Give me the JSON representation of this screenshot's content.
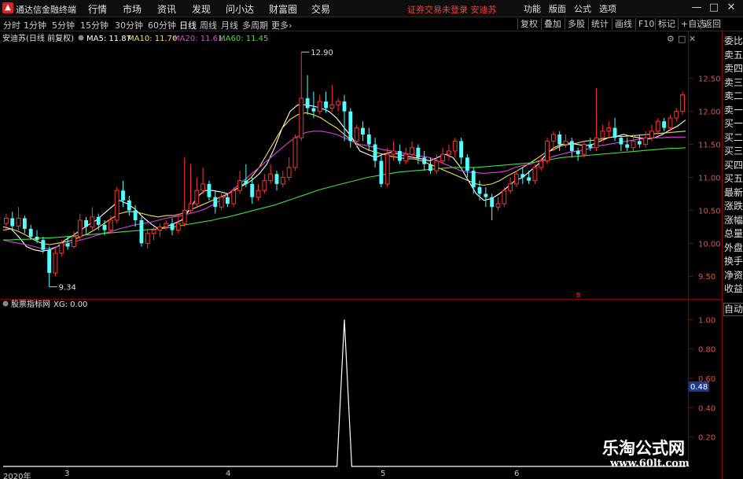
{
  "menubar": {
    "app_name": "通达信金融终端",
    "menus": [
      "行情",
      "市场",
      "资讯",
      "发现",
      "问小达",
      "财富圈",
      "交易"
    ],
    "notice": "证券交易未登录",
    "stock_name": "安迪苏",
    "right_menus": [
      "功能",
      "版面",
      "公式",
      "选项"
    ],
    "window_buttons": [
      "—",
      "□",
      "✕"
    ]
  },
  "toolbar": {
    "periods": [
      "分时",
      "1分钟",
      "5分钟",
      "15分钟",
      "30分钟",
      "60分钟",
      "日线",
      "周线",
      "月线",
      "多周期",
      "更多"
    ],
    "active_period": "日线",
    "buttons": [
      "复权",
      "叠加",
      "多股",
      "统计",
      "画线",
      "F10",
      "标记",
      "+自选",
      "返回"
    ]
  },
  "main_chart": {
    "title": "安迪苏(日线 前复权)",
    "ma_labels": [
      {
        "text": "MA5: 11.87",
        "color": "#ffffff"
      },
      {
        "text": "MA10: 11.70",
        "color": "#f0e060"
      },
      {
        "text": "MA20: 11.61",
        "color": "#e040e0"
      },
      {
        "text": "MA60: 11.45",
        "color": "#40e040"
      }
    ],
    "high_label": "12.90",
    "low_label": "9.34",
    "marker": "B"
  },
  "sub_chart": {
    "title": "股票指标网",
    "xg_label": "XG: 0.00",
    "current_value": "0.48"
  },
  "side_panel": {
    "items": [
      "委比",
      "卖五",
      "卖四",
      "卖三",
      "卖二",
      "卖一",
      "买一",
      "买二",
      "买三",
      "买四",
      "买五",
      "最新",
      "涨跌",
      "涨幅",
      "总量",
      "外盘",
      "换手",
      "净资",
      "收益"
    ],
    "auto_label": "自动"
  },
  "date_axis": [
    "2020年",
    "3",
    "4",
    "5",
    "6"
  ],
  "watermark": {
    "title": "乐淘公式网",
    "url": "www.60lt.com"
  },
  "colors": {
    "up": "#ff3232",
    "down": "#54ffff",
    "ma5": "#ffffff",
    "ma10": "#f0e060",
    "ma20": "#e040e0",
    "ma60": "#40e040",
    "frame": "#880000"
  },
  "chart_data": [
    {
      "type": "candlestick",
      "title": "安迪苏(日线 前复权)",
      "ylim": [
        9.3,
        12.95
      ],
      "y_ticks": [
        9.5,
        10.0,
        10.5,
        11.0,
        11.5,
        12.0,
        12.5
      ],
      "candles": [
        [
          10.3,
          10.38,
          10.45,
          10.18
        ],
        [
          10.38,
          10.26,
          10.48,
          10.2
        ],
        [
          10.26,
          10.38,
          10.55,
          10.2
        ],
        [
          10.38,
          10.22,
          10.42,
          10.15
        ],
        [
          10.22,
          10.1,
          10.28,
          10.05
        ],
        [
          10.1,
          10.05,
          10.2,
          10.0
        ],
        [
          10.05,
          9.9,
          10.1,
          9.85
        ],
        [
          9.9,
          9.55,
          9.95,
          9.34
        ],
        [
          9.55,
          9.85,
          9.92,
          9.5
        ],
        [
          9.85,
          10.0,
          10.05,
          9.8
        ],
        [
          10.0,
          9.95,
          10.1,
          9.9
        ],
        [
          9.95,
          10.1,
          10.18,
          9.92
        ],
        [
          10.1,
          10.35,
          10.45,
          10.05
        ],
        [
          10.35,
          10.25,
          10.4,
          10.15
        ],
        [
          10.25,
          10.4,
          10.55,
          10.2
        ],
        [
          10.4,
          10.28,
          10.45,
          10.2
        ],
        [
          10.28,
          10.2,
          10.35,
          10.12
        ],
        [
          10.2,
          10.35,
          10.42,
          10.15
        ],
        [
          10.35,
          10.8,
          10.85,
          10.3
        ],
        [
          10.8,
          10.65,
          10.95,
          10.55
        ],
        [
          10.65,
          10.5,
          10.72,
          10.42
        ],
        [
          10.5,
          10.35,
          10.58,
          10.25
        ],
        [
          10.35,
          10.0,
          10.4,
          9.95
        ],
        [
          10.0,
          10.15,
          10.22,
          9.92
        ],
        [
          10.15,
          10.2,
          10.25,
          10.05
        ],
        [
          10.2,
          10.25,
          10.3,
          10.1
        ],
        [
          10.25,
          10.3,
          10.35,
          10.2
        ],
        [
          10.3,
          10.2,
          10.38,
          10.12
        ],
        [
          10.2,
          10.3,
          10.45,
          10.15
        ],
        [
          10.3,
          10.5,
          11.3,
          10.25
        ],
        [
          10.5,
          10.6,
          11.2,
          10.45
        ],
        [
          10.6,
          10.8,
          11.0,
          10.55
        ],
        [
          10.8,
          10.9,
          11.15,
          10.75
        ],
        [
          10.9,
          10.7,
          10.95,
          10.65
        ],
        [
          10.7,
          10.55,
          10.8,
          10.45
        ],
        [
          10.55,
          10.7,
          10.78,
          10.5
        ],
        [
          10.7,
          10.6,
          10.75,
          10.55
        ],
        [
          10.6,
          10.8,
          10.85,
          10.55
        ],
        [
          10.8,
          10.95,
          11.1,
          10.75
        ],
        [
          10.95,
          10.9,
          11.2,
          10.85
        ],
        [
          10.9,
          10.7,
          11.0,
          10.6
        ],
        [
          10.7,
          10.8,
          10.9,
          10.65
        ],
        [
          10.8,
          10.95,
          11.05,
          10.75
        ],
        [
          10.95,
          11.05,
          11.2,
          10.9
        ],
        [
          11.05,
          10.9,
          11.1,
          10.8
        ],
        [
          10.9,
          11.0,
          11.1,
          10.85
        ],
        [
          11.0,
          11.15,
          11.3,
          10.95
        ],
        [
          11.15,
          11.6,
          11.65,
          11.1
        ],
        [
          11.6,
          12.2,
          12.9,
          11.55
        ],
        [
          12.2,
          12.05,
          12.55,
          11.95
        ],
        [
          12.05,
          12.0,
          12.3,
          11.9
        ],
        [
          12.0,
          12.15,
          12.25,
          11.95
        ],
        [
          12.15,
          12.05,
          12.3,
          11.98
        ],
        [
          12.05,
          12.1,
          12.4,
          12.0
        ],
        [
          12.1,
          12.15,
          12.2,
          12.0
        ],
        [
          12.15,
          12.0,
          12.25,
          11.55
        ],
        [
          12.0,
          11.55,
          12.05,
          11.45
        ],
        [
          11.55,
          11.75,
          11.8,
          11.45
        ],
        [
          11.75,
          11.65,
          11.85,
          11.55
        ],
        [
          11.65,
          11.5,
          11.75,
          11.4
        ],
        [
          11.5,
          11.25,
          11.6,
          11.15
        ],
        [
          11.25,
          10.9,
          11.35,
          10.85
        ],
        [
          10.9,
          11.35,
          11.45,
          10.85
        ],
        [
          11.35,
          11.4,
          11.55,
          11.25
        ],
        [
          11.4,
          11.25,
          11.5,
          11.2
        ],
        [
          11.25,
          11.35,
          11.45,
          11.2
        ],
        [
          11.35,
          11.45,
          11.55,
          11.3
        ],
        [
          11.45,
          11.3,
          11.5,
          11.2
        ],
        [
          11.3,
          11.2,
          11.4,
          11.1
        ],
        [
          11.2,
          11.1,
          11.3,
          11.05
        ],
        [
          11.1,
          11.25,
          11.35,
          11.05
        ],
        [
          11.25,
          11.35,
          11.45,
          11.2
        ],
        [
          11.35,
          11.4,
          11.5,
          11.25
        ],
        [
          11.4,
          11.55,
          11.6,
          11.3
        ],
        [
          11.55,
          11.3,
          11.6,
          11.2
        ],
        [
          11.3,
          11.1,
          11.35,
          11.0
        ],
        [
          11.1,
          10.85,
          11.15,
          10.75
        ],
        [
          10.85,
          10.75,
          10.95,
          10.65
        ],
        [
          10.75,
          10.7,
          10.85,
          10.55
        ],
        [
          10.7,
          10.55,
          10.75,
          10.35
        ],
        [
          10.55,
          10.6,
          10.7,
          10.5
        ],
        [
          10.6,
          10.8,
          10.85,
          10.55
        ],
        [
          10.8,
          10.9,
          11.0,
          10.75
        ],
        [
          10.9,
          11.05,
          11.1,
          10.85
        ],
        [
          11.05,
          11.0,
          11.15,
          10.9
        ],
        [
          11.0,
          10.95,
          11.1,
          10.9
        ],
        [
          10.95,
          11.15,
          11.2,
          10.9
        ],
        [
          11.15,
          11.25,
          11.3,
          11.1
        ],
        [
          11.25,
          11.55,
          11.6,
          11.2
        ],
        [
          11.55,
          11.65,
          11.7,
          11.4
        ],
        [
          11.65,
          11.5,
          11.7,
          11.4
        ],
        [
          11.5,
          11.55,
          11.65,
          11.45
        ],
        [
          11.55,
          11.4,
          11.6,
          11.3
        ],
        [
          11.4,
          11.35,
          11.45,
          11.25
        ],
        [
          11.35,
          11.5,
          11.55,
          11.3
        ],
        [
          11.5,
          11.45,
          11.6,
          11.4
        ],
        [
          11.45,
          11.6,
          12.35,
          11.4
        ],
        [
          11.6,
          11.7,
          11.8,
          11.55
        ],
        [
          11.7,
          11.75,
          11.85,
          11.6
        ],
        [
          11.75,
          11.6,
          11.9,
          11.55
        ],
        [
          11.6,
          11.5,
          11.65,
          11.4
        ],
        [
          11.5,
          11.45,
          11.6,
          11.4
        ],
        [
          11.45,
          11.55,
          11.65,
          11.4
        ],
        [
          11.55,
          11.5,
          11.65,
          11.45
        ],
        [
          11.5,
          11.6,
          11.7,
          11.45
        ],
        [
          11.6,
          11.7,
          11.8,
          11.55
        ],
        [
          11.7,
          11.85,
          11.9,
          11.65
        ],
        [
          11.85,
          11.75,
          11.9,
          11.7
        ],
        [
          11.75,
          11.9,
          11.95,
          11.7
        ],
        [
          11.9,
          12.0,
          12.05,
          11.85
        ],
        [
          12.0,
          12.25,
          12.3,
          11.95
        ]
      ],
      "ma": {
        "MA5": [
          10.25,
          10.22,
          10.1,
          9.95,
          9.9,
          9.88,
          9.9,
          9.95,
          10.05,
          10.12,
          10.2,
          10.28,
          10.35,
          10.45,
          10.55,
          10.65,
          10.6,
          10.52,
          10.4,
          10.3,
          10.22,
          10.25,
          10.3,
          10.35,
          10.5,
          10.7,
          10.8,
          10.8,
          10.78,
          10.75,
          10.82,
          10.88,
          10.95,
          11.05,
          11.2,
          11.45,
          11.75,
          12.0,
          12.1,
          12.1,
          12.08,
          12.05,
          12.0,
          11.9,
          11.75,
          11.6,
          11.4,
          11.35,
          11.3,
          11.35,
          11.38,
          11.35,
          11.32,
          11.3,
          11.28,
          11.25,
          11.3,
          11.35,
          11.3,
          11.15,
          10.95,
          10.75,
          10.65,
          10.68,
          10.75,
          10.85,
          10.95,
          11.0,
          11.1,
          11.2,
          11.35,
          11.45,
          11.5,
          11.52,
          11.5,
          11.48,
          11.5,
          11.55,
          11.6,
          11.62,
          11.65,
          11.62,
          11.6,
          11.58,
          11.6,
          11.65,
          11.72,
          11.78,
          11.87
        ],
        "MA10": [
          10.2,
          10.22,
          10.18,
          10.12,
          10.05,
          10.0,
          9.98,
          10.0,
          10.02,
          10.05,
          10.1,
          10.15,
          10.22,
          10.3,
          10.38,
          10.45,
          10.48,
          10.48,
          10.45,
          10.42,
          10.4,
          10.42,
          10.42,
          10.45,
          10.5,
          10.55,
          10.6,
          10.65,
          10.7,
          10.75,
          10.82,
          10.9,
          11.0,
          11.15,
          11.35,
          11.55,
          11.75,
          11.88,
          11.95,
          11.98,
          11.95,
          11.9,
          11.82,
          11.75,
          11.65,
          11.55,
          11.48,
          11.42,
          11.38,
          11.35,
          11.32,
          11.3,
          11.28,
          11.28,
          11.25,
          11.2,
          11.15,
          11.1,
          11.05,
          11.0,
          10.95,
          10.9,
          10.88,
          10.9,
          10.95,
          11.02,
          11.08,
          11.15,
          11.22,
          11.3,
          11.38,
          11.42,
          11.48,
          11.5,
          11.52,
          11.55,
          11.56,
          11.58,
          11.6,
          11.62,
          11.62,
          11.63,
          11.64,
          11.65,
          11.66,
          11.67,
          11.68,
          11.69,
          11.7
        ],
        "MA20": [
          10.05,
          10.02,
          10.0,
          9.98,
          9.95,
          9.92,
          9.92,
          9.95,
          9.98,
          10.02,
          10.05,
          10.08,
          10.12,
          10.15,
          10.18,
          10.22,
          10.25,
          10.28,
          10.3,
          10.32,
          10.35,
          10.38,
          10.4,
          10.42,
          10.45,
          10.48,
          10.52,
          10.58,
          10.65,
          10.75,
          10.85,
          10.95,
          11.05,
          11.15,
          11.25,
          11.35,
          11.45,
          11.55,
          11.62,
          11.68,
          11.7,
          11.7,
          11.68,
          11.65,
          11.6,
          11.55,
          11.5,
          11.48,
          11.45,
          11.42,
          11.4,
          11.38,
          11.36,
          11.34,
          11.32,
          11.3,
          11.25,
          11.2,
          11.15,
          11.1,
          11.08,
          11.07,
          11.06,
          11.07,
          11.08,
          11.1,
          11.15,
          11.18,
          11.2,
          11.25,
          11.28,
          11.32,
          11.35,
          11.38,
          11.4,
          11.42,
          11.45,
          11.48,
          11.5,
          11.52,
          11.54,
          11.56,
          11.58,
          11.59,
          11.6,
          11.6,
          11.61,
          11.61,
          11.61
        ],
        "MA60": [
          10.05,
          10.05,
          10.06,
          10.06,
          10.07,
          10.08,
          10.08,
          10.09,
          10.1,
          10.11,
          10.12,
          10.13,
          10.14,
          10.15,
          10.16,
          10.17,
          10.18,
          10.19,
          10.2,
          10.21,
          10.22,
          10.23,
          10.25,
          10.27,
          10.29,
          10.31,
          10.33,
          10.35,
          10.38,
          10.4,
          10.43,
          10.46,
          10.49,
          10.52,
          10.55,
          10.58,
          10.62,
          10.66,
          10.7,
          10.74,
          10.78,
          10.82,
          10.85,
          10.88,
          10.91,
          10.94,
          10.97,
          11.0,
          11.02,
          11.04,
          11.06,
          11.08,
          11.09,
          11.1,
          11.11,
          11.12,
          11.13,
          11.14,
          11.15,
          11.15,
          11.15,
          11.15,
          11.16,
          11.17,
          11.18,
          11.19,
          11.2,
          11.21,
          11.22,
          11.24,
          11.26,
          11.28,
          11.3,
          11.31,
          11.32,
          11.33,
          11.34,
          11.35,
          11.36,
          11.37,
          11.38,
          11.39,
          11.4,
          11.41,
          11.42,
          11.43,
          11.44,
          11.44,
          11.45
        ]
      }
    },
    {
      "type": "line",
      "title": "股票指标网",
      "ylim": [
        0,
        1.05
      ],
      "y_ticks": [
        0.2,
        0.4,
        0.6,
        0.8,
        1.0
      ],
      "series": [
        {
          "name": "XG",
          "peak_index": 55,
          "peak_value": 1.0,
          "length": 111
        }
      ]
    }
  ]
}
